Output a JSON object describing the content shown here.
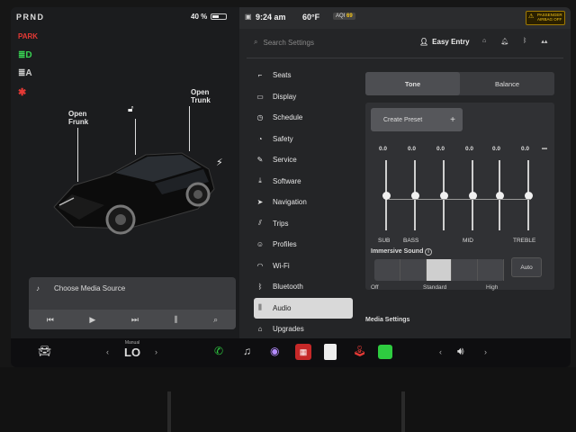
{
  "status": {
    "gear": "PRND",
    "battery_percent": "40 %",
    "battery_level": 0.4,
    "time": "9:24 am",
    "temperature": "60°F",
    "aqi_label": "AQI",
    "aqi_value": "69",
    "airbag_line1": "PASSENGER",
    "airbag_line2": "AIRBAG OFF"
  },
  "vehicle": {
    "frunk_label": "Open\nFrunk",
    "trunk_label": "Open\nTrunk"
  },
  "media": {
    "source_placeholder": "Choose Media Source"
  },
  "settings": {
    "search_placeholder": "Search Settings",
    "profile": "Easy Entry",
    "nav": [
      {
        "label": "Seats",
        "icon": "seat-icon"
      },
      {
        "label": "Display",
        "icon": "display-icon"
      },
      {
        "label": "Schedule",
        "icon": "clock-icon"
      },
      {
        "label": "Safety",
        "icon": "safety-icon"
      },
      {
        "label": "Service",
        "icon": "wrench-icon"
      },
      {
        "label": "Software",
        "icon": "download-icon"
      },
      {
        "label": "Navigation",
        "icon": "navigation-icon"
      },
      {
        "label": "Trips",
        "icon": "trips-icon"
      },
      {
        "label": "Profiles",
        "icon": "profile-icon"
      },
      {
        "label": "Wi-Fi",
        "icon": "wifi-icon"
      },
      {
        "label": "Bluetooth",
        "icon": "bluetooth-icon"
      },
      {
        "label": "Audio",
        "icon": "audio-icon"
      },
      {
        "label": "Upgrades",
        "icon": "upgrades-icon"
      }
    ],
    "active_nav": "Audio"
  },
  "audio": {
    "tabs": [
      "Tone",
      "Balance"
    ],
    "active_tab": "Tone",
    "create_preset": "Create Preset",
    "eq_values": [
      "0.0",
      "0.0",
      "0.0",
      "0.0",
      "0.0",
      "0.0"
    ],
    "eq_labels": [
      "SUB",
      "BASS",
      "MID",
      "TREBLE"
    ],
    "immersive_label": "Immersive Sound",
    "immersive_levels": [
      "Off",
      "Standard",
      "High"
    ],
    "immersive_selected": "Standard",
    "auto_label": "Auto",
    "media_settings": "Media Settings"
  },
  "taskbar": {
    "climate_mode": "Manual",
    "climate_value": "LO"
  },
  "colors": {
    "phone_green": "#2ecc40",
    "brake_red": "#e53935",
    "light_green": "#39d353",
    "warning_yellow": "#f5c518"
  }
}
